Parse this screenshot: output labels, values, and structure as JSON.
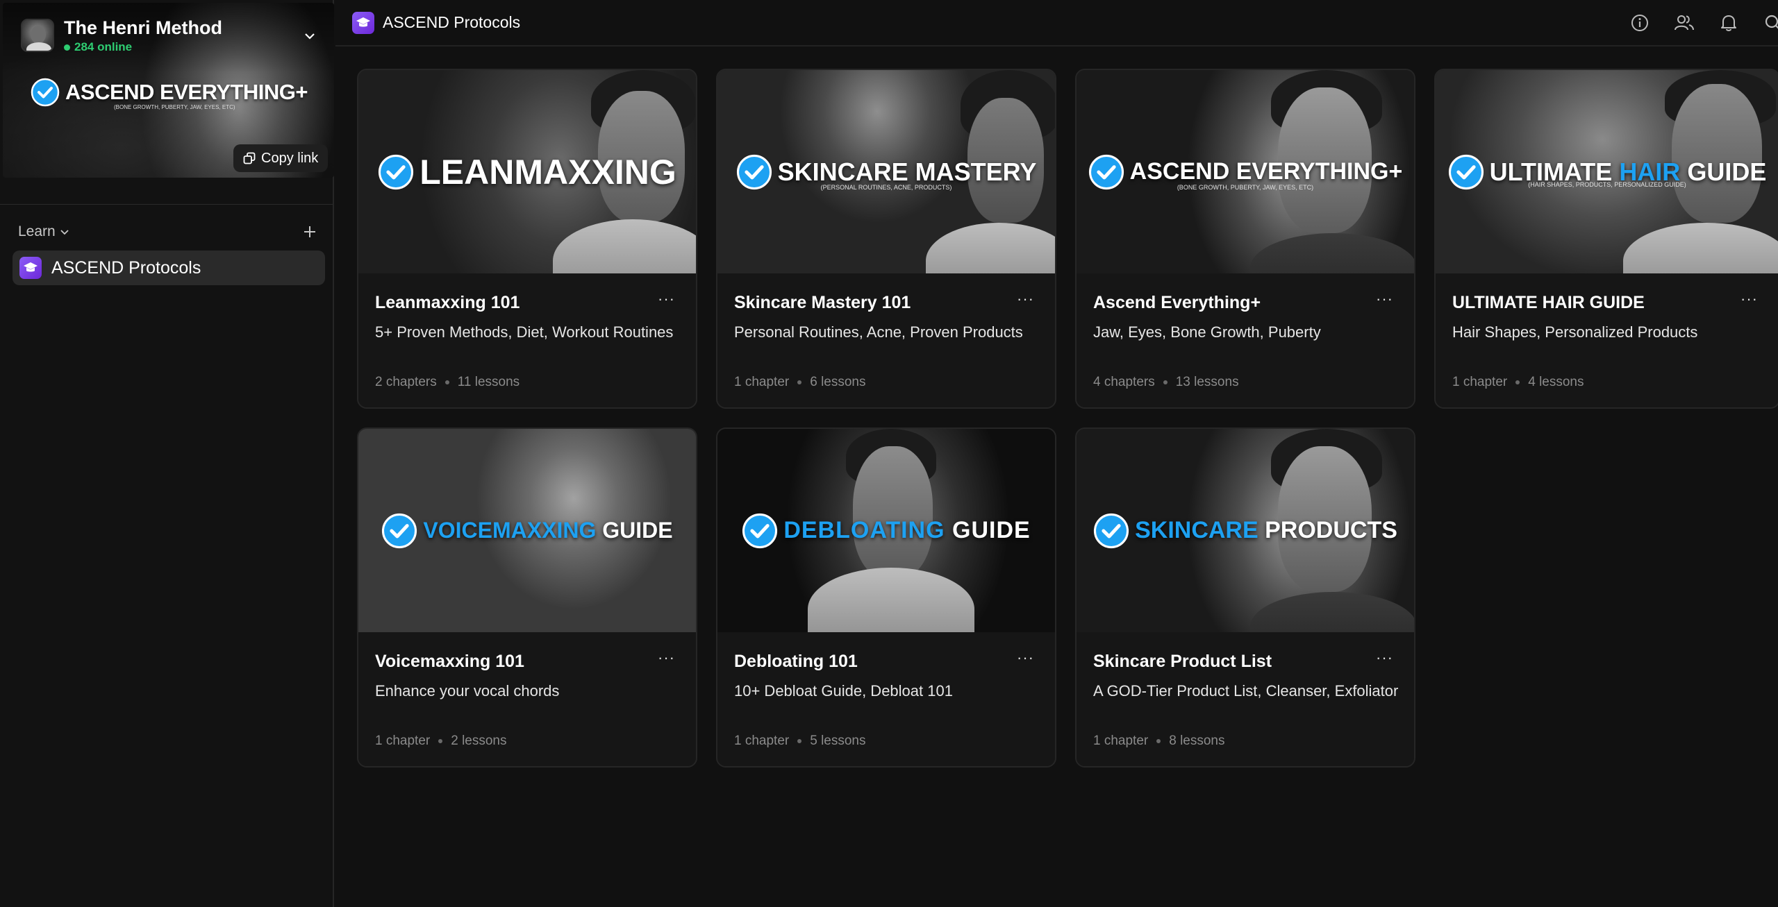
{
  "server": {
    "name": "The Henri Method",
    "online": "284 online",
    "banner_title": "ASCEND EVERYTHING+",
    "banner_subtitle": "(BONE GROWTH, PUBERTY, JAW, EYES, ETC)",
    "copy_link": "Copy link"
  },
  "sidebar": {
    "section_label": "Learn",
    "items": [
      {
        "label": "ASCEND Protocols",
        "icon": "graduation-cap-icon",
        "active": true
      }
    ]
  },
  "topbar": {
    "title": "ASCEND Protocols",
    "icons": [
      "info-icon",
      "members-icon",
      "bell-icon",
      "search-icon"
    ]
  },
  "colors": {
    "accent_purple": "#7c3aed",
    "accent_blue": "#1da1f2",
    "online_green": "#2ecc71",
    "background": "#111111"
  },
  "courses": [
    {
      "thumb_w1": "LEANMAXXING",
      "thumb_w2": "",
      "thumb_w3": "",
      "thumb_sub": "",
      "title": "Leanmaxxing 101",
      "desc": "5+ Proven Methods, Diet, Workout Routines",
      "chapters": "2 chapters",
      "lessons": "11 lessons"
    },
    {
      "thumb_w1": "SKINCARE MASTERY",
      "thumb_w2": "",
      "thumb_w3": "",
      "thumb_sub": "(PERSONAL ROUTINES, ACNE, PRODUCTS)",
      "title": "Skincare Mastery 101",
      "desc": "Personal Routines, Acne, Proven Products",
      "chapters": "1 chapter",
      "lessons": "6 lessons"
    },
    {
      "thumb_w1": "ASCEND EVERYTHING+",
      "thumb_w2": "",
      "thumb_w3": "",
      "thumb_sub": "(BONE GROWTH, PUBERTY, JAW, EYES, ETC)",
      "title": "Ascend Everything+",
      "desc": "Jaw, Eyes, Bone Growth, Puberty",
      "chapters": "4 chapters",
      "lessons": "13 lessons"
    },
    {
      "thumb_w1": "ULTIMATE ",
      "thumb_w2": "HAIR",
      "thumb_w3": " GUIDE",
      "thumb_sub": "(HAIR SHAPES, PRODUCTS, PERSONALIZED GUIDE)",
      "title": "ULTIMATE HAIR GUIDE",
      "desc": "Hair Shapes, Personalized Products",
      "chapters": "1 chapter",
      "lessons": "4 lessons"
    },
    {
      "thumb_w1": "",
      "thumb_w2": "VOICEMAXXING",
      "thumb_w3": " GUIDE",
      "thumb_sub": "",
      "title": "Voicemaxxing 101",
      "desc": "Enhance your vocal chords",
      "chapters": "1 chapter",
      "lessons": "2 lessons"
    },
    {
      "thumb_w1": "",
      "thumb_w2": "DEBLOATING",
      "thumb_w3": " GUIDE",
      "thumb_sub": "",
      "title": "Debloating 101",
      "desc": "10+ Debloat Guide, Debloat 101",
      "chapters": "1 chapter",
      "lessons": "5 lessons"
    },
    {
      "thumb_w1": "",
      "thumb_w2": "SKINCARE",
      "thumb_w3": " PRODUCTS",
      "thumb_sub": "",
      "title": "Skincare Product List",
      "desc": "A GOD-Tier Product List, Cleanser, Exfoliator",
      "chapters": "1 chapter",
      "lessons": "8 lessons"
    }
  ]
}
